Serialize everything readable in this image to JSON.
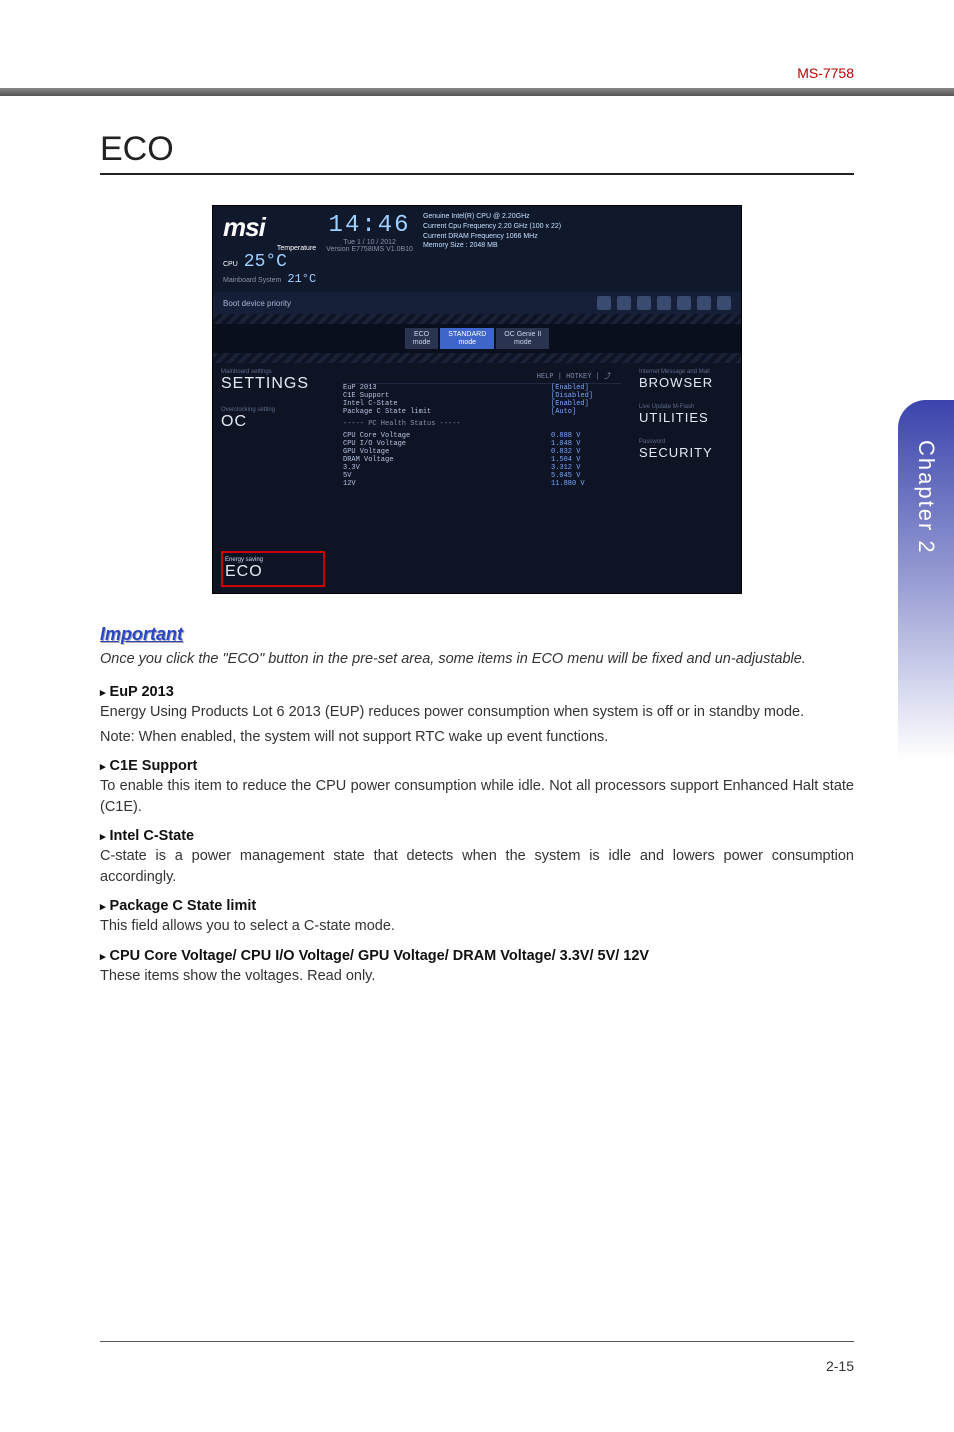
{
  "model": "MS-7758",
  "side_tab": "Chapter 2",
  "page_title": "ECO",
  "page_number": "2-15",
  "bios": {
    "logo": "msi",
    "temp_label": "Temperature",
    "cpu_label": "CPU",
    "cpu_temp": "25°C",
    "mb_label": "Mainboard System",
    "mb_temp": "21°C",
    "clock": "14:46",
    "date": "Tue  1 / 10 / 2012",
    "version": "Version E7758IMS V1.0B10",
    "sysinfo": [
      "Genuine Intel(R) CPU @ 2.20GHz",
      "Current Cpu Frequency 2.20 GHz (100 x 22)",
      "Current DRAM Frequency 1066 MHz",
      "Memory Size : 2048 MB"
    ],
    "boot_label": "Boot device priority",
    "mode_tabs": [
      {
        "top": "ECO",
        "bot": "mode"
      },
      {
        "top": "STANDARD",
        "bot": "mode"
      },
      {
        "top": "OC Genie II",
        "bot": "mode"
      }
    ],
    "help_bar": "HELP  |  HOTKEY  |  ⤴",
    "left_nav": [
      {
        "label": "Mainboard settings",
        "big": "SETTINGS"
      },
      {
        "label": "Overclocking setting",
        "big": "OC"
      },
      {
        "label": "Energy saving",
        "big": "ECO"
      }
    ],
    "settings_rows": [
      {
        "k": "EuP 2013",
        "v": "[Enabled]"
      },
      {
        "k": "C1E Support",
        "v": "[Disabled]"
      },
      {
        "k": "Intel C-State",
        "v": "[Enabled]"
      },
      {
        "k": "Package C State limit",
        "v": "[Auto]"
      }
    ],
    "health_header": "----- PC Health Status -----",
    "health_rows": [
      {
        "k": "CPU Core Voltage",
        "v": "0.888 V"
      },
      {
        "k": "CPU I/O Voltage",
        "v": "1.048 V"
      },
      {
        "k": "GPU Voltage",
        "v": "0.832 V"
      },
      {
        "k": "DRAM Voltage",
        "v": "1.504 V"
      },
      {
        "k": "3.3V",
        "v": "3.312 V"
      },
      {
        "k": "5V",
        "v": "5.045 V"
      },
      {
        "k": "12V",
        "v": "11.880 V"
      }
    ],
    "right_nav": [
      {
        "label": "Internet Message and Mail",
        "big": "BROWSER"
      },
      {
        "label": "Live Update M-Flash",
        "big": "UTILITIES"
      },
      {
        "label": "Password",
        "big": "SECURITY"
      }
    ]
  },
  "important": {
    "heading": "Important",
    "body": "Once you click the \"ECO\" button in the pre-set area, some items in ECO menu will be fixed and un-adjustable."
  },
  "sections": [
    {
      "head": "EuP 2013",
      "body": "Energy Using Products Lot 6 2013 (EUP) reduces power consumption when system is off or in standby mode.",
      "note": "Note: When enabled, the system will not support RTC wake up event functions."
    },
    {
      "head": "C1E Support",
      "body": "To enable this item to reduce the CPU power consumption while idle. Not all processors support Enhanced Halt state (C1E)."
    },
    {
      "head": "Intel C-State",
      "body": "C-state is a power management state that detects when the system is idle and lowers power consumption accordingly."
    },
    {
      "head": "Package C State limit",
      "body": "This field allows you to select a C-state mode."
    },
    {
      "head": "CPU Core Voltage/ CPU I/O Voltage/ GPU Voltage/ DRAM Voltage/ 3.3V/ 5V/ 12V",
      "body": "These items show the voltages. Read only."
    }
  ]
}
